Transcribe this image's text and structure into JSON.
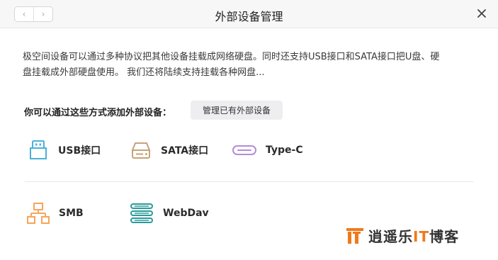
{
  "window": {
    "title": "外部设备管理",
    "nav_back": "‹",
    "nav_forward": "›"
  },
  "description": {
    "line1": "极空间设备可以通过多种协议把其他设备挂载成网络硬盘。同时还支持USB接口和SATA接口把U盘、硬",
    "line2": "盘挂载成外部硬盘使用。 我们还将陆续支持挂载各种网盘..."
  },
  "add_section": {
    "label": "你可以通过这些方式添加外部设备：",
    "manage_button": "管理已有外部设备"
  },
  "methods": [
    {
      "label": "USB接口",
      "icon": "usb-icon",
      "color": "#4bb0d8"
    },
    {
      "label": "SATA接口",
      "icon": "sata-drive-icon",
      "color": "#c8a27a"
    },
    {
      "label": "Type-C",
      "icon": "type-c-icon",
      "color": "#b58bd8"
    },
    {
      "label": "SMB",
      "icon": "network-share-icon",
      "color": "#f5a55a"
    },
    {
      "label": "WebDav",
      "icon": "server-stack-icon",
      "color": "#2a9a9a"
    }
  ],
  "watermark": {
    "logo_letter": "IT",
    "text_part1": "逍遥乐",
    "text_accent": "IT",
    "text_part2": "博客",
    "accent_color": "#f07a1a"
  }
}
